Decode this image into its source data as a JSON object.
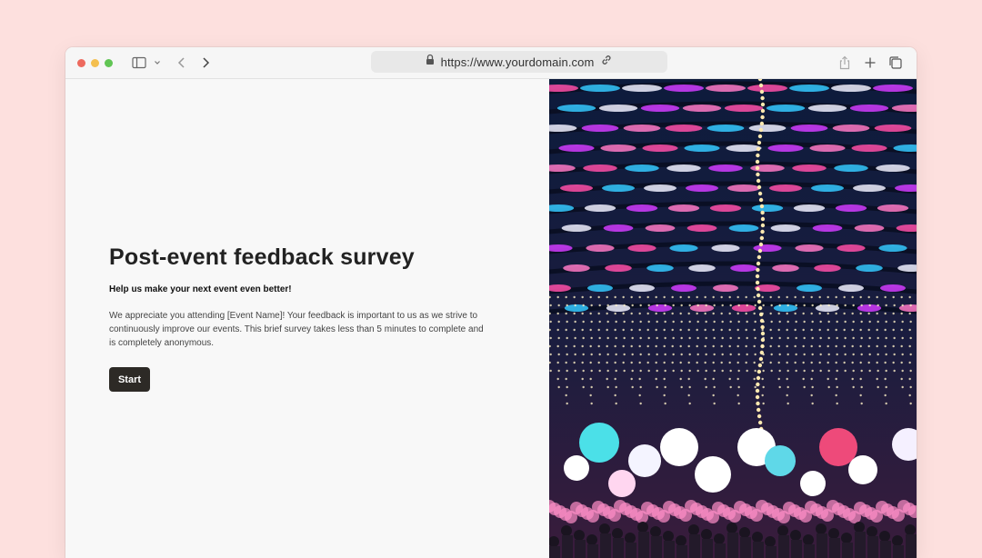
{
  "browser": {
    "url": "https://www.yourdomain.com",
    "icons": [
      "sidebar-icon",
      "chevron-down-icon",
      "back-arrow-icon",
      "forward-arrow-icon",
      "lock-icon",
      "link-icon",
      "share-icon",
      "new-tab-icon",
      "tabs-overview-icon"
    ]
  },
  "page": {
    "title": "Post-event feedback survey",
    "subtitle": "Help us make your next event even better!",
    "description": "We appreciate you attending [Event Name]! Your feedback is important to us as we strive to continuously improve our events. This brief survey takes less than 5 minutes to complete and is completely anonymous.",
    "start_label": "Start"
  },
  "colors": {
    "page_background": "#fde0de",
    "button_background": "#2d2a26",
    "title_text": "#222222"
  }
}
